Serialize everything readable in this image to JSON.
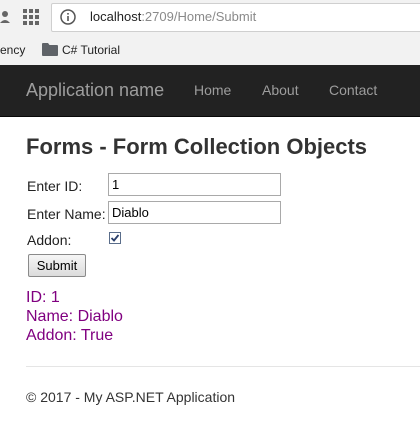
{
  "browser": {
    "url_host": "localhost",
    "url_path": ":2709/Home/Submit",
    "bookmarks": [
      "ency",
      "C# Tutorial"
    ]
  },
  "navbar": {
    "brand": "Application name",
    "links": [
      "Home",
      "About",
      "Contact"
    ]
  },
  "page": {
    "title": "Forms - Form Collection Objects"
  },
  "form": {
    "id_label": "Enter ID:",
    "id_value": "1",
    "name_label": "Enter Name:",
    "name_value": "Diablo",
    "addon_label": "Addon:",
    "addon_checked": true,
    "submit_label": "Submit"
  },
  "result": {
    "id_line": "ID: 1",
    "name_line": "Name: Diablo",
    "addon_line": "Addon: True",
    "color": "#800080"
  },
  "footer": {
    "text": "© 2017 - My ASP.NET Application"
  },
  "colors": {
    "navbar_bg": "#222222",
    "navbar_text": "#9d9d9d"
  }
}
